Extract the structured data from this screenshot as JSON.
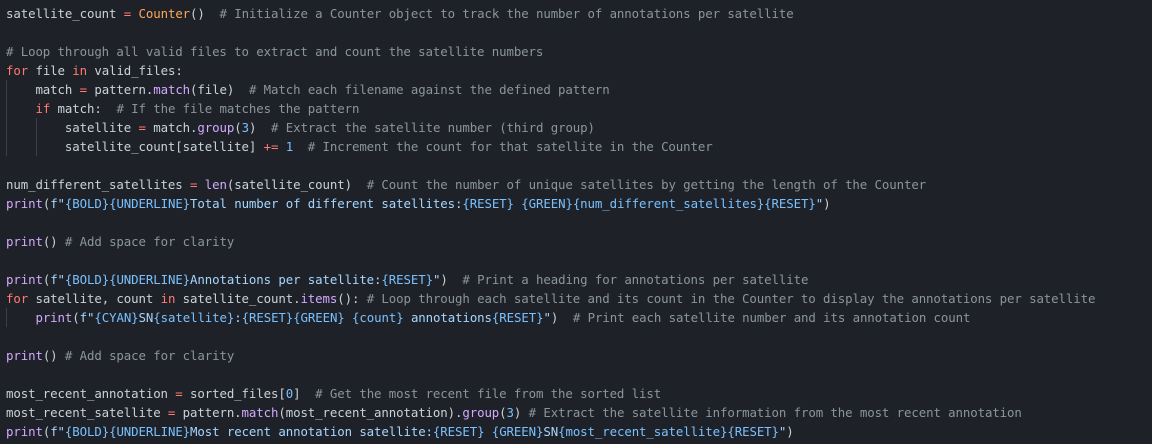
{
  "colors": {
    "background": "#1e2228",
    "default": "#c9d1d9",
    "keyword": "#ff7b72",
    "func": "#d2a8ff",
    "class": "#ffa657",
    "comment": "#8b949e",
    "string": "#a5d6ff",
    "number": "#79c0ff",
    "interp": "#79c0ff"
  },
  "code": {
    "lines": [
      {
        "indent": 0,
        "tokens": [
          {
            "t": "satellite_count ",
            "c": "var"
          },
          {
            "t": "=",
            "c": "op"
          },
          {
            "t": " ",
            "c": "default"
          },
          {
            "t": "Counter",
            "c": "class"
          },
          {
            "t": "()",
            "c": "default"
          },
          {
            "t": "  # Initialize a Counter object to track the number of annotations per satellite",
            "c": "comment"
          }
        ]
      },
      {
        "indent": 0,
        "tokens": []
      },
      {
        "indent": 0,
        "tokens": [
          {
            "t": "# Loop through all valid files to extract and count the satellite numbers",
            "c": "comment"
          }
        ]
      },
      {
        "indent": 0,
        "tokens": [
          {
            "t": "for",
            "c": "keyword"
          },
          {
            "t": " file ",
            "c": "var"
          },
          {
            "t": "in",
            "c": "keyword"
          },
          {
            "t": " valid_files:",
            "c": "var"
          }
        ]
      },
      {
        "indent": 1,
        "tokens": [
          {
            "t": "    match ",
            "c": "var"
          },
          {
            "t": "=",
            "c": "op"
          },
          {
            "t": " pattern.",
            "c": "var"
          },
          {
            "t": "match",
            "c": "func"
          },
          {
            "t": "(file)",
            "c": "var"
          },
          {
            "t": "  # Match each filename against the defined pattern",
            "c": "comment"
          }
        ]
      },
      {
        "indent": 1,
        "tokens": [
          {
            "t": "    ",
            "c": "default"
          },
          {
            "t": "if",
            "c": "keyword"
          },
          {
            "t": " match:",
            "c": "var"
          },
          {
            "t": "  # If the file matches the pattern",
            "c": "comment"
          }
        ]
      },
      {
        "indent": 2,
        "tokens": [
          {
            "t": "        satellite ",
            "c": "var"
          },
          {
            "t": "=",
            "c": "op"
          },
          {
            "t": " match.",
            "c": "var"
          },
          {
            "t": "group",
            "c": "func"
          },
          {
            "t": "(",
            "c": "var"
          },
          {
            "t": "3",
            "c": "number"
          },
          {
            "t": ")",
            "c": "var"
          },
          {
            "t": "  # Extract the satellite number (third group)",
            "c": "comment"
          }
        ]
      },
      {
        "indent": 2,
        "tokens": [
          {
            "t": "        satellite_count[satellite] ",
            "c": "var"
          },
          {
            "t": "+=",
            "c": "op"
          },
          {
            "t": " ",
            "c": "default"
          },
          {
            "t": "1",
            "c": "number"
          },
          {
            "t": "  # Increment the count for that satellite in the Counter",
            "c": "comment"
          }
        ]
      },
      {
        "indent": 0,
        "tokens": []
      },
      {
        "indent": 0,
        "tokens": [
          {
            "t": "num_different_satellites ",
            "c": "var"
          },
          {
            "t": "=",
            "c": "op"
          },
          {
            "t": " ",
            "c": "default"
          },
          {
            "t": "len",
            "c": "func"
          },
          {
            "t": "(satellite_count)",
            "c": "var"
          },
          {
            "t": "  # Count the number of unique satellites by getting the length of the Counter",
            "c": "comment"
          }
        ]
      },
      {
        "indent": 0,
        "tokens": [
          {
            "t": "print",
            "c": "func"
          },
          {
            "t": "(",
            "c": "var"
          },
          {
            "t": "f\"",
            "c": "string"
          },
          {
            "t": "{BOLD}{UNDERLINE}",
            "c": "interp"
          },
          {
            "t": "Total number of different satellites:",
            "c": "string"
          },
          {
            "t": "{RESET}",
            "c": "interp"
          },
          {
            "t": " ",
            "c": "string"
          },
          {
            "t": "{GREEN}",
            "c": "interp"
          },
          {
            "t": "{num_different_satellites}",
            "c": "interp"
          },
          {
            "t": "{RESET}",
            "c": "interp"
          },
          {
            "t": "\"",
            "c": "string"
          },
          {
            "t": ")",
            "c": "var"
          }
        ]
      },
      {
        "indent": 0,
        "tokens": []
      },
      {
        "indent": 0,
        "tokens": [
          {
            "t": "print",
            "c": "func"
          },
          {
            "t": "()",
            "c": "var"
          },
          {
            "t": " # Add space for clarity",
            "c": "comment"
          }
        ]
      },
      {
        "indent": 0,
        "tokens": []
      },
      {
        "indent": 0,
        "tokens": [
          {
            "t": "print",
            "c": "func"
          },
          {
            "t": "(",
            "c": "var"
          },
          {
            "t": "f\"",
            "c": "string"
          },
          {
            "t": "{BOLD}{UNDERLINE}",
            "c": "interp"
          },
          {
            "t": "Annotations per satellite:",
            "c": "string"
          },
          {
            "t": "{RESET}",
            "c": "interp"
          },
          {
            "t": "\"",
            "c": "string"
          },
          {
            "t": ")",
            "c": "var"
          },
          {
            "t": "  # Print a heading for annotations per satellite",
            "c": "comment"
          }
        ]
      },
      {
        "indent": 0,
        "tokens": [
          {
            "t": "for",
            "c": "keyword"
          },
          {
            "t": " satellite, count ",
            "c": "var"
          },
          {
            "t": "in",
            "c": "keyword"
          },
          {
            "t": " satellite_count.",
            "c": "var"
          },
          {
            "t": "items",
            "c": "func"
          },
          {
            "t": "():",
            "c": "var"
          },
          {
            "t": " # Loop through each satellite and its count in the Counter to display the annotations per satellite",
            "c": "comment"
          }
        ]
      },
      {
        "indent": 1,
        "tokens": [
          {
            "t": "    ",
            "c": "default"
          },
          {
            "t": "print",
            "c": "func"
          },
          {
            "t": "(",
            "c": "var"
          },
          {
            "t": "f\"",
            "c": "string"
          },
          {
            "t": "{CYAN}",
            "c": "interp"
          },
          {
            "t": "SN",
            "c": "string"
          },
          {
            "t": "{satellite}",
            "c": "interp"
          },
          {
            "t": ":",
            "c": "string"
          },
          {
            "t": "{RESET}{GREEN}",
            "c": "interp"
          },
          {
            "t": " ",
            "c": "string"
          },
          {
            "t": "{count}",
            "c": "interp"
          },
          {
            "t": " annotations",
            "c": "string"
          },
          {
            "t": "{RESET}",
            "c": "interp"
          },
          {
            "t": "\"",
            "c": "string"
          },
          {
            "t": ")",
            "c": "var"
          },
          {
            "t": "  # Print each satellite number and its annotation count",
            "c": "comment"
          }
        ]
      },
      {
        "indent": 0,
        "tokens": []
      },
      {
        "indent": 0,
        "tokens": [
          {
            "t": "print",
            "c": "func"
          },
          {
            "t": "()",
            "c": "var"
          },
          {
            "t": " # Add space for clarity",
            "c": "comment"
          }
        ]
      },
      {
        "indent": 0,
        "tokens": []
      },
      {
        "indent": 0,
        "tokens": [
          {
            "t": "most_recent_annotation ",
            "c": "var"
          },
          {
            "t": "=",
            "c": "op"
          },
          {
            "t": " sorted_files[",
            "c": "var"
          },
          {
            "t": "0",
            "c": "number"
          },
          {
            "t": "]",
            "c": "var"
          },
          {
            "t": "  # Get the most recent file from the sorted list",
            "c": "comment"
          }
        ]
      },
      {
        "indent": 0,
        "tokens": [
          {
            "t": "most_recent_satellite ",
            "c": "var"
          },
          {
            "t": "=",
            "c": "op"
          },
          {
            "t": " pattern.",
            "c": "var"
          },
          {
            "t": "match",
            "c": "func"
          },
          {
            "t": "(most_recent_annotation).",
            "c": "var"
          },
          {
            "t": "group",
            "c": "func"
          },
          {
            "t": "(",
            "c": "var"
          },
          {
            "t": "3",
            "c": "number"
          },
          {
            "t": ")",
            "c": "var"
          },
          {
            "t": " # Extract the satellite information from the most recent annotation",
            "c": "comment"
          }
        ]
      },
      {
        "indent": 0,
        "tokens": [
          {
            "t": "print",
            "c": "func"
          },
          {
            "t": "(",
            "c": "var"
          },
          {
            "t": "f\"",
            "c": "string"
          },
          {
            "t": "{BOLD}{UNDERLINE}",
            "c": "interp"
          },
          {
            "t": "Most recent annotation satellite:",
            "c": "string"
          },
          {
            "t": "{RESET}",
            "c": "interp"
          },
          {
            "t": " ",
            "c": "string"
          },
          {
            "t": "{GREEN}",
            "c": "interp"
          },
          {
            "t": "SN",
            "c": "string"
          },
          {
            "t": "{most_recent_satellite}",
            "c": "interp"
          },
          {
            "t": "{RESET}",
            "c": "interp"
          },
          {
            "t": "\"",
            "c": "string"
          },
          {
            "t": ")",
            "c": "var"
          }
        ]
      }
    ]
  }
}
